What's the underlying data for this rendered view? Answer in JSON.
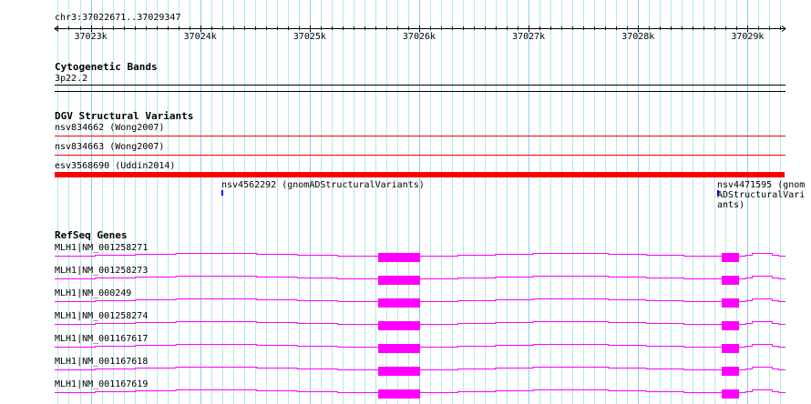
{
  "ruler": {
    "location": "chr3:37022671..37029347",
    "start": 37022671,
    "end": 37029347,
    "tick_labels": [
      "37023k",
      "37024k",
      "37025k",
      "37026k",
      "37027k",
      "37028k",
      "37029k"
    ]
  },
  "colors": {
    "grid_minor": "#b4e8ee",
    "grid_major": "#90c8ea",
    "dgv": "#ff0000",
    "gnomad": "#0000ff",
    "refseq": "#ff00ff"
  },
  "tracks": {
    "cytoband": {
      "title": "Cytogenetic Bands",
      "band": "3p22.2"
    },
    "dgv": {
      "title": "DGV Structural Variants",
      "items": [
        {
          "label": "nsv834662 (Wong2007)"
        },
        {
          "label": "nsv834663 (Wong2007)"
        },
        {
          "label": "esv3568690 (Uddin2014)"
        }
      ]
    },
    "gnomad": {
      "items": [
        {
          "label": "nsv4562292 (gnomADStructuralVariants)"
        },
        {
          "label": "nsv4471595 (gnomADStructuralVariants)"
        }
      ]
    },
    "refseq": {
      "title": "RefSeq Genes",
      "items": [
        {
          "label": "MLH1|NM_001258271"
        },
        {
          "label": "MLH1|NM_001258273"
        },
        {
          "label": "MLH1|NM_000249"
        },
        {
          "label": "MLH1|NM_001258274"
        },
        {
          "label": "MLH1|NM_001167617"
        },
        {
          "label": "MLH1|NM_001167618"
        },
        {
          "label": "MLH1|NM_001167619"
        }
      ]
    }
  }
}
